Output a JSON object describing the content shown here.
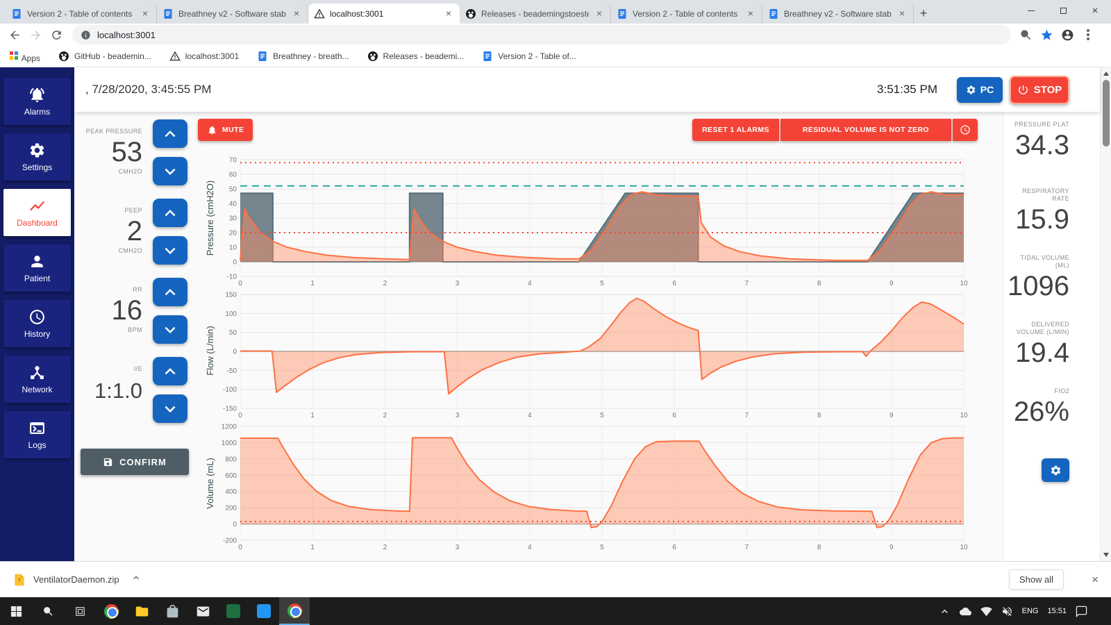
{
  "browser": {
    "tabs": [
      {
        "title": "Version 2 - Table of contents",
        "icon": "docs"
      },
      {
        "title": "Breathney v2 - Software stab",
        "icon": "docs"
      },
      {
        "title": "localhost:3001",
        "icon": "warning",
        "active": true
      },
      {
        "title": "Releases - beademingstoeste",
        "icon": "github"
      },
      {
        "title": "Version 2 - Table of contents",
        "icon": "docs"
      },
      {
        "title": "Breathney v2 - Software stab",
        "icon": "docs"
      }
    ],
    "address": "localhost:3001",
    "bookmarks": [
      {
        "label": "Apps",
        "icon": "apps"
      },
      {
        "label": "GitHub - beademin...",
        "icon": "github"
      },
      {
        "label": "localhost:3001",
        "icon": "warning"
      },
      {
        "label": "Breathney - breath...",
        "icon": "docs"
      },
      {
        "label": "Releases - beademi...",
        "icon": "github"
      },
      {
        "label": "Version 2 - Table of...",
        "icon": "docs"
      }
    ]
  },
  "header": {
    "datetime": ", 7/28/2020, 3:45:55 PM",
    "clock": "3:51:35 PM",
    "pc_label": "PC",
    "stop_label": "STOP"
  },
  "sidebar": {
    "items": [
      {
        "label": "Alarms"
      },
      {
        "label": "Settings"
      },
      {
        "label": "Dashboard",
        "active": true
      },
      {
        "label": "Patient"
      },
      {
        "label": "History"
      },
      {
        "label": "Network"
      },
      {
        "label": "Logs"
      }
    ]
  },
  "controls": {
    "params": [
      {
        "label": "PEAK PRESSURE",
        "value": "53",
        "unit": "CMH2O"
      },
      {
        "label": "PEEP",
        "value": "2",
        "unit": "CMH2O"
      },
      {
        "label": "RR",
        "value": "16",
        "unit": "BPM"
      },
      {
        "label": "I/E",
        "value": "1:1.0",
        "unit": ""
      }
    ],
    "confirm_label": "CONFIRM"
  },
  "alarm_bar": {
    "mute_label": "MUTE",
    "reset_label": "RESET 1 ALARMS",
    "message": "RESIDUAL VOLUME IS NOT ZERO"
  },
  "readings": [
    {
      "label": "PRESSURE PLAT",
      "value": "34.3"
    },
    {
      "label": "RESPIRATORY RATE",
      "value": "15.9"
    },
    {
      "label": "TIDAL VOLUME (ML)",
      "value": "1096"
    },
    {
      "label": "DELIVERED VOLUME (L/MIN)",
      "value": "19.4"
    },
    {
      "label": "FIO2",
      "value": "26%"
    }
  ],
  "download_bar": {
    "filename": "VentilatorDaemon.zip",
    "show_all": "Show all"
  },
  "taskbar": {
    "language": "ENG",
    "time": "15:51"
  },
  "chart_data": [
    {
      "type": "line",
      "ylabel": "Pressure (cmH2O)",
      "xlim": [
        0,
        10
      ],
      "ylim": [
        -10,
        70
      ],
      "yticks": [
        70,
        60,
        50,
        40,
        30,
        20,
        10,
        0,
        -10
      ],
      "xticks": [
        0,
        1,
        2,
        3,
        4,
        5,
        6,
        7,
        8,
        9,
        10
      ],
      "grid": true,
      "thresholds": [
        {
          "y": 68,
          "color": "#f44336",
          "style": "dotted"
        },
        {
          "y": 52,
          "color": "#26a69a",
          "style": "dashed"
        },
        {
          "y": 20,
          "color": "#f44336",
          "style": "dotted"
        }
      ],
      "series": [
        {
          "name": "set-pressure",
          "color": "#546e7a",
          "fill": "rgba(85,105,115,0.8)",
          "points": [
            [
              0,
              47
            ],
            [
              0.45,
              47
            ],
            [
              0.45,
              0
            ],
            [
              2.34,
              0
            ],
            [
              2.34,
              47
            ],
            [
              2.8,
              47
            ],
            [
              2.8,
              0
            ],
            [
              4.68,
              0
            ],
            [
              5.32,
              47
            ],
            [
              6.33,
              47
            ],
            [
              6.33,
              0
            ],
            [
              8.67,
              0
            ],
            [
              9.3,
              47
            ],
            [
              10,
              47
            ]
          ]
        },
        {
          "name": "measured-pressure",
          "color": "#ff7043",
          "fill": "rgba(255,145,100,0.45)",
          "points": [
            [
              0,
              1
            ],
            [
              0.06,
              36
            ],
            [
              0.14,
              29
            ],
            [
              0.28,
              20
            ],
            [
              0.45,
              14
            ],
            [
              0.65,
              10
            ],
            [
              0.9,
              7
            ],
            [
              1.2,
              4.5
            ],
            [
              1.55,
              3
            ],
            [
              2,
              2
            ],
            [
              2.34,
              1.5
            ],
            [
              2.4,
              36
            ],
            [
              2.48,
              29
            ],
            [
              2.62,
              20
            ],
            [
              2.8,
              14
            ],
            [
              3,
              10
            ],
            [
              3.25,
              7
            ],
            [
              3.55,
              4.5
            ],
            [
              3.95,
              3
            ],
            [
              4.4,
              2
            ],
            [
              4.68,
              2
            ],
            [
              4.85,
              8
            ],
            [
              5.05,
              22
            ],
            [
              5.25,
              38
            ],
            [
              5.4,
              46
            ],
            [
              5.55,
              48
            ],
            [
              5.75,
              46
            ],
            [
              6,
              45
            ],
            [
              6.33,
              45
            ],
            [
              6.37,
              27
            ],
            [
              6.5,
              17
            ],
            [
              6.68,
              11
            ],
            [
              6.9,
              7
            ],
            [
              7.2,
              4
            ],
            [
              7.6,
              2
            ],
            [
              8.2,
              1
            ],
            [
              8.67,
              1
            ],
            [
              8.85,
              8
            ],
            [
              9.05,
              22
            ],
            [
              9.25,
              38
            ],
            [
              9.4,
              46
            ],
            [
              9.55,
              48
            ],
            [
              9.75,
              46
            ],
            [
              10,
              46
            ]
          ]
        }
      ]
    },
    {
      "type": "line",
      "ylabel": "Flow (L/min)",
      "xlim": [
        0,
        10
      ],
      "ylim": [
        -150,
        150
      ],
      "yticks": [
        150,
        100,
        50,
        0,
        -50,
        -100,
        -150
      ],
      "xticks": [
        0,
        1,
        2,
        3,
        4,
        5,
        6,
        7,
        8,
        9,
        10
      ],
      "grid": true,
      "thresholds": [],
      "series": [
        {
          "name": "flow",
          "color": "#ff7043",
          "fill": "rgba(255,145,100,0.45)",
          "points": [
            [
              0,
              1
            ],
            [
              0.44,
              1
            ],
            [
              0.5,
              -108
            ],
            [
              0.62,
              -90
            ],
            [
              0.78,
              -68
            ],
            [
              0.96,
              -47
            ],
            [
              1.16,
              -29
            ],
            [
              1.38,
              -16
            ],
            [
              1.62,
              -8
            ],
            [
              1.95,
              -3
            ],
            [
              2.4,
              -1
            ],
            [
              2.82,
              -1
            ],
            [
              2.88,
              -112
            ],
            [
              3,
              -93
            ],
            [
              3.16,
              -70
            ],
            [
              3.35,
              -48
            ],
            [
              3.58,
              -29
            ],
            [
              3.83,
              -15
            ],
            [
              4.12,
              -7
            ],
            [
              4.5,
              -2
            ],
            [
              4.7,
              1
            ],
            [
              4.82,
              12
            ],
            [
              4.98,
              35
            ],
            [
              5.12,
              68
            ],
            [
              5.26,
              103
            ],
            [
              5.38,
              128
            ],
            [
              5.48,
              140
            ],
            [
              5.58,
              132
            ],
            [
              5.72,
              112
            ],
            [
              5.88,
              92
            ],
            [
              6.05,
              75
            ],
            [
              6.2,
              63
            ],
            [
              6.33,
              55
            ],
            [
              6.38,
              -74
            ],
            [
              6.5,
              -57
            ],
            [
              6.65,
              -41
            ],
            [
              6.85,
              -26
            ],
            [
              7.1,
              -14
            ],
            [
              7.4,
              -6
            ],
            [
              7.8,
              -2
            ],
            [
              8.3,
              -1
            ],
            [
              8.6,
              -1
            ],
            [
              8.65,
              -13
            ],
            [
              8.72,
              3
            ],
            [
              8.85,
              24
            ],
            [
              9,
              54
            ],
            [
              9.15,
              88
            ],
            [
              9.3,
              116
            ],
            [
              9.42,
              130
            ],
            [
              9.54,
              125
            ],
            [
              9.68,
              110
            ],
            [
              9.84,
              92
            ],
            [
              10,
              72
            ]
          ]
        }
      ]
    },
    {
      "type": "line",
      "ylabel": "Volume (mL)",
      "xlim": [
        0,
        10
      ],
      "ylim": [
        -200,
        1200
      ],
      "yticks": [
        1200,
        1000,
        800,
        600,
        400,
        200,
        0,
        -200
      ],
      "xticks": [
        0,
        1,
        2,
        3,
        4,
        5,
        6,
        7,
        8,
        9,
        10
      ],
      "grid": true,
      "thresholds": [
        {
          "y": 30,
          "color": "#f44336",
          "style": "dotted"
        }
      ],
      "series": [
        {
          "name": "volume",
          "color": "#ff7043",
          "fill": "rgba(255,145,100,0.45)",
          "points": [
            [
              0,
              1055
            ],
            [
              0.52,
              1055
            ],
            [
              0.6,
              930
            ],
            [
              0.73,
              740
            ],
            [
              0.88,
              555
            ],
            [
              1.05,
              405
            ],
            [
              1.25,
              292
            ],
            [
              1.5,
              216
            ],
            [
              1.8,
              178
            ],
            [
              2.15,
              160
            ],
            [
              2.34,
              156
            ],
            [
              2.38,
              1060
            ],
            [
              2.92,
              1060
            ],
            [
              3,
              930
            ],
            [
              3.13,
              740
            ],
            [
              3.3,
              548
            ],
            [
              3.5,
              398
            ],
            [
              3.72,
              288
            ],
            [
              3.98,
              216
            ],
            [
              4.3,
              178
            ],
            [
              4.62,
              160
            ],
            [
              4.79,
              156
            ],
            [
              4.85,
              -45
            ],
            [
              4.93,
              -32
            ],
            [
              5,
              30
            ],
            [
              5.12,
              210
            ],
            [
              5.28,
              520
            ],
            [
              5.45,
              800
            ],
            [
              5.6,
              950
            ],
            [
              5.75,
              1012
            ],
            [
              6,
              1018
            ],
            [
              6.34,
              1018
            ],
            [
              6.42,
              900
            ],
            [
              6.56,
              722
            ],
            [
              6.73,
              532
            ],
            [
              6.93,
              382
            ],
            [
              7.16,
              278
            ],
            [
              7.43,
              208
            ],
            [
              7.76,
              175
            ],
            [
              8.2,
              160
            ],
            [
              8.73,
              156
            ],
            [
              8.8,
              -45
            ],
            [
              8.88,
              -30
            ],
            [
              8.96,
              40
            ],
            [
              9.08,
              230
            ],
            [
              9.24,
              560
            ],
            [
              9.4,
              850
            ],
            [
              9.55,
              1000
            ],
            [
              9.7,
              1048
            ],
            [
              9.85,
              1058
            ],
            [
              10,
              1058
            ]
          ]
        }
      ]
    }
  ]
}
